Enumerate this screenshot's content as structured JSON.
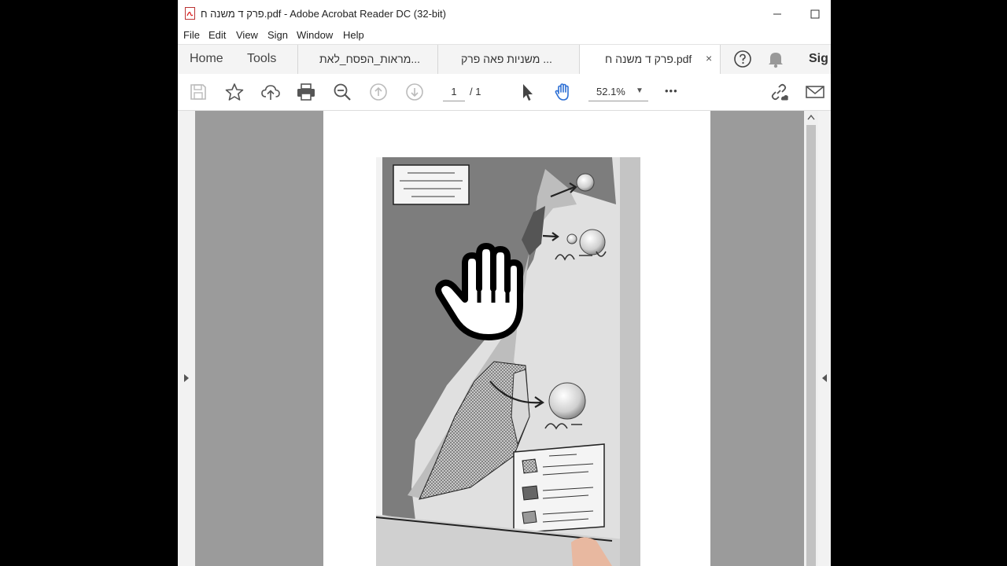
{
  "window": {
    "title": "פרק ד משנה ח.pdf - Adobe Acrobat Reader DC (32-bit)",
    "minimize_label": "—",
    "maximize_label": "☐"
  },
  "menu": [
    "File",
    "Edit",
    "View",
    "Sign",
    "Window",
    "Help"
  ],
  "tabs": {
    "home": "Home",
    "tools": "Tools",
    "documents": [
      {
        "label": "מראות_הפסח_לאת..."
      },
      {
        "label": "משניות פאה פרק ..."
      },
      {
        "label": "פרק ד משנה ח.pdf",
        "close": "×"
      }
    ],
    "sign_label": "Sig"
  },
  "toolbar": {
    "current_page": "1",
    "total_pages": "/ 1",
    "zoom": "52.1%",
    "more": "•••"
  },
  "icons": [
    "pdf-file-icon",
    "save-icon",
    "bookmark-star-icon",
    "upload-cloud-icon",
    "print-icon",
    "zoom-out-icon",
    "page-up-icon",
    "page-down-icon",
    "select-pointer-icon",
    "hand-tool-icon",
    "more-icon",
    "share-link-icon",
    "email-icon",
    "help-icon",
    "notification-bell-icon",
    "hand-cursor-icon"
  ],
  "colors": {
    "toolbar_bg": "#ffffff",
    "tabbar_bg": "#f4f4f4",
    "canvas_bg": "#9b9b9b",
    "accent": "#2d6fd4"
  },
  "document": {
    "map": {
      "legend_title": "מקרא",
      "legend_items": [
        "מגליל עד בדבר [הלה חות]",
        "מכדבר עד חשבה [2 חלות]",
        "מחשבה ולבנון [2 חלות]"
      ],
      "handwritten": [
        "מאור לבן",
        "לבן"
      ]
    }
  }
}
